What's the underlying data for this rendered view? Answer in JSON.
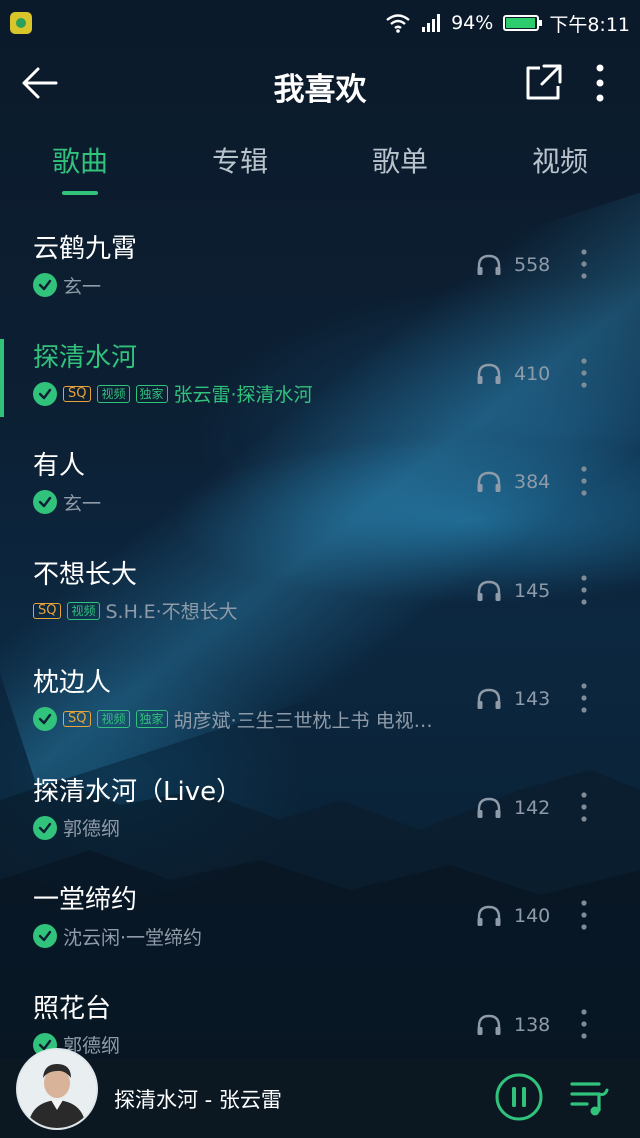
{
  "status_bar": {
    "battery": "94%",
    "battery_level": 0.94,
    "time": "下午8:11"
  },
  "header": {
    "title": "我喜欢"
  },
  "tabs": [
    {
      "label": "歌曲",
      "active": true
    },
    {
      "label": "专辑",
      "active": false
    },
    {
      "label": "歌单",
      "active": false
    },
    {
      "label": "视频",
      "active": false
    }
  ],
  "songs": [
    {
      "title": "云鹤九霄",
      "meta": "玄一",
      "plays": "558",
      "checked": true,
      "badges": []
    },
    {
      "title": "探清水河",
      "meta": "张云雷·探清水河",
      "plays": "410",
      "checked": true,
      "badges": [
        "SQ",
        "视频",
        "独家"
      ],
      "active": true
    },
    {
      "title": "有人",
      "meta": "玄一",
      "plays": "384",
      "checked": true,
      "badges": []
    },
    {
      "title": "不想长大",
      "meta": "S.H.E·不想长大",
      "plays": "145",
      "checked": false,
      "badges": [
        "SQ",
        "视频"
      ]
    },
    {
      "title": "枕边人",
      "meta": "胡彦斌·三生三世枕上书 电视…",
      "plays": "143",
      "checked": true,
      "badges": [
        "SQ",
        "视频",
        "独家"
      ]
    },
    {
      "title": "探清水河（Live）",
      "meta": "郭德纲",
      "plays": "142",
      "checked": true,
      "badges": []
    },
    {
      "title": "一堂缔约",
      "meta": "沈云闲·一堂缔约",
      "plays": "140",
      "checked": true,
      "badges": []
    },
    {
      "title": "照花台",
      "meta": "郭德纲",
      "plays": "138",
      "checked": true,
      "badges": []
    }
  ],
  "player": {
    "now_playing": "探清水河 - 张云雷"
  },
  "colors": {
    "accent": "#31c27c",
    "sq": "#e8a33a",
    "secondary_text": "#8f9ba8"
  }
}
